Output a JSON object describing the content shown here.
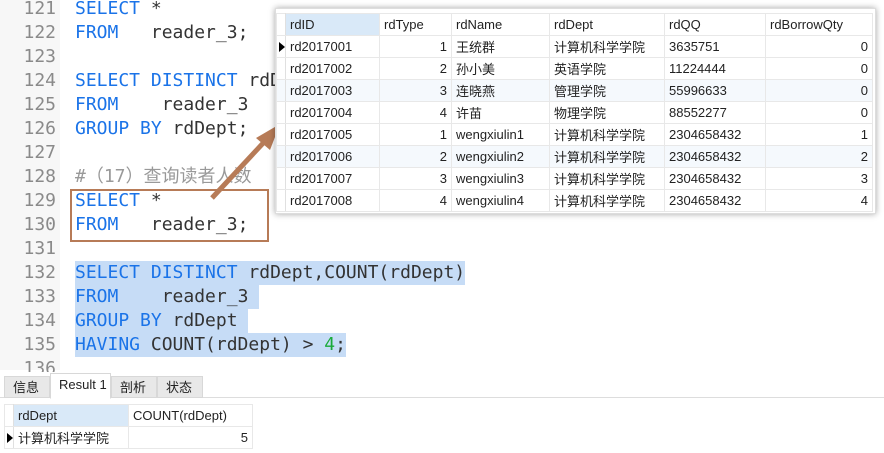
{
  "editor": {
    "lines": [
      {
        "n": "121",
        "parts": [
          [
            "kw",
            "SELECT "
          ],
          [
            "",
            "*"
          ]
        ]
      },
      {
        "n": "122",
        "parts": [
          [
            "kw",
            "FROM"
          ],
          [
            "",
            "   reader_3;"
          ]
        ]
      },
      {
        "n": "123",
        "parts": []
      },
      {
        "n": "124",
        "parts": [
          [
            "kw",
            "SELECT DISTINCT "
          ],
          [
            "",
            "rdDept,COUNT(rdDept)"
          ]
        ]
      },
      {
        "n": "125",
        "parts": [
          [
            "kw",
            "FROM"
          ],
          [
            "",
            "    reader_3"
          ]
        ]
      },
      {
        "n": "126",
        "parts": [
          [
            "kw",
            "GROUP BY "
          ],
          [
            "",
            "rdDept;"
          ]
        ]
      },
      {
        "n": "127",
        "parts": []
      },
      {
        "n": "128",
        "parts": [
          [
            "cm",
            "#（17）查询读者人数"
          ]
        ]
      },
      {
        "n": "129",
        "parts": [
          [
            "kw",
            "SELECT "
          ],
          [
            "",
            "*"
          ]
        ]
      },
      {
        "n": "130",
        "parts": [
          [
            "kw",
            "FROM"
          ],
          [
            "",
            "   reader_3;"
          ]
        ]
      },
      {
        "n": "131",
        "parts": []
      },
      {
        "n": "132",
        "parts": [
          [
            "kw",
            "SELECT DISTINCT "
          ],
          [
            "",
            "rdDept,COUNT(rdDept)"
          ]
        ],
        "sel": true
      },
      {
        "n": "133",
        "parts": [
          [
            "kw",
            "FROM"
          ],
          [
            "",
            "    reader_3 "
          ]
        ],
        "sel": true
      },
      {
        "n": "134",
        "parts": [
          [
            "kw",
            "GROUP BY "
          ],
          [
            "",
            "rdDept "
          ]
        ],
        "sel": true
      },
      {
        "n": "135",
        "parts": [
          [
            "kw",
            "HAVING "
          ],
          [
            "",
            "COUNT(rdDept) > "
          ],
          [
            "num",
            "4"
          ],
          [
            "",
            ";"
          ]
        ],
        "sel": true
      },
      {
        "n": "136",
        "parts": []
      }
    ]
  },
  "popup": {
    "columns": [
      "rdID",
      "rdType",
      "rdName",
      "rdDept",
      "rdQQ",
      "rdBorrowQty"
    ],
    "rows": [
      [
        "rd2017001",
        "1",
        "王统群",
        "计算机科学学院",
        "3635751",
        "0"
      ],
      [
        "rd2017002",
        "2",
        "孙小美",
        "英语学院",
        "11224444",
        "0"
      ],
      [
        "rd2017003",
        "3",
        "连晓燕",
        "管理学院",
        "55996633",
        "0"
      ],
      [
        "rd2017004",
        "4",
        "许苗",
        "物理学院",
        "88552277",
        "0"
      ],
      [
        "rd2017005",
        "1",
        "wengxiulin1",
        "计算机科学学院",
        "2304658432",
        "1"
      ],
      [
        "rd2017006",
        "2",
        "wengxiulin2",
        "计算机科学学院",
        "2304658432",
        "2"
      ],
      [
        "rd2017007",
        "3",
        "wengxiulin3",
        "计算机科学学院",
        "2304658432",
        "3"
      ],
      [
        "rd2017008",
        "4",
        "wengxiulin4",
        "计算机科学学院",
        "2304658432",
        "4"
      ]
    ]
  },
  "tabs": [
    {
      "label": "信息"
    },
    {
      "label": "Result 1",
      "active": true
    },
    {
      "label": "剖析"
    },
    {
      "label": "状态"
    }
  ],
  "result": {
    "columns": [
      "rdDept",
      "COUNT(rdDept)"
    ],
    "rows": [
      [
        "计算机科学学院",
        "5"
      ]
    ]
  },
  "colors": {
    "keyword": "#1a73e8",
    "selection": "#c6dcf6",
    "annotation": "#b77b57",
    "number": "#1aaa3a"
  }
}
